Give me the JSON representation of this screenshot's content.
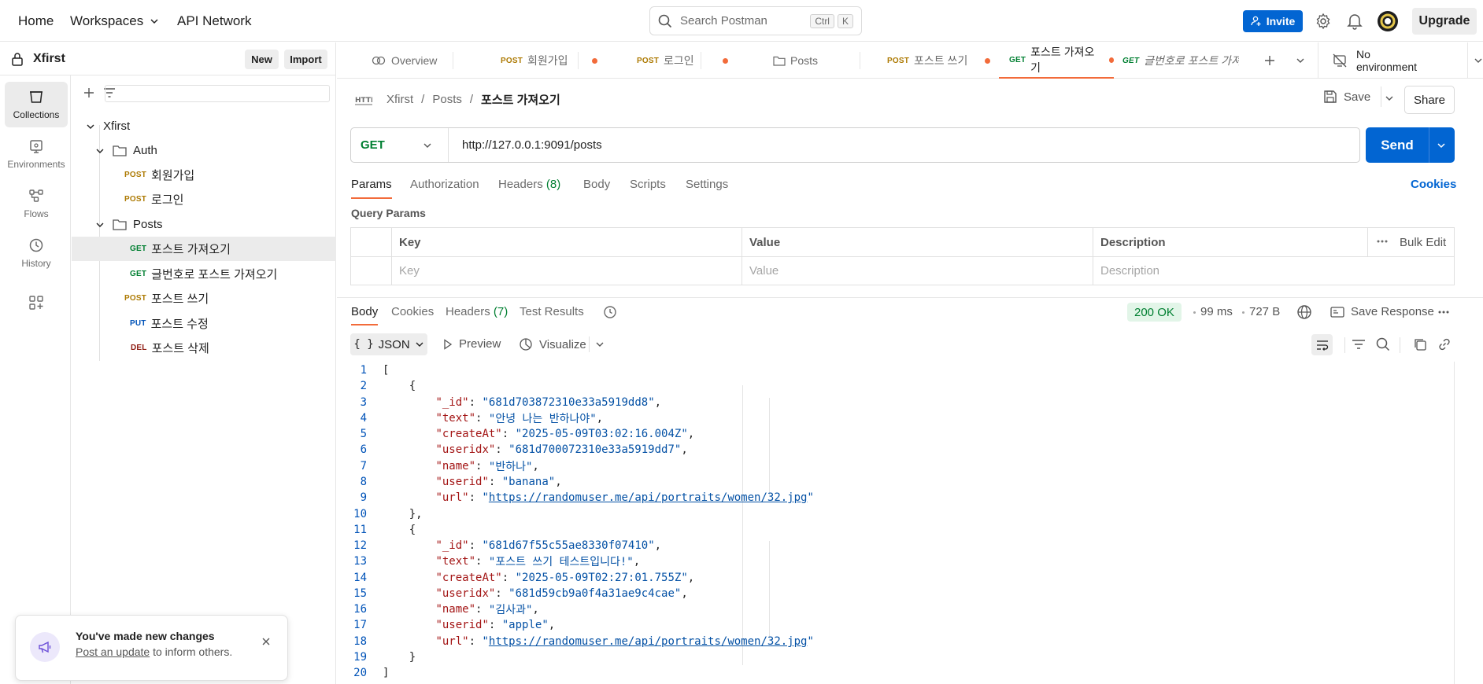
{
  "topbar": {
    "home": "Home",
    "workspaces": "Workspaces",
    "api_network": "API Network",
    "search_placeholder": "Search Postman",
    "kbd_ctrl": "Ctrl",
    "kbd_k": "K",
    "invite": "Invite",
    "upgrade": "Upgrade"
  },
  "workspace": {
    "name": "Xfirst",
    "new_label": "New",
    "import_label": "Import"
  },
  "rail": [
    {
      "label": "Collections",
      "icon": "collections-icon"
    },
    {
      "label": "Environments",
      "icon": "environments-icon"
    },
    {
      "label": "Flows",
      "icon": "flows-icon"
    },
    {
      "label": "History",
      "icon": "history-icon"
    }
  ],
  "tree": {
    "collection": "Xfirst",
    "auth_folder": "Auth",
    "posts_folder": "Posts",
    "items": [
      {
        "method": "POST",
        "name": "회원가입"
      },
      {
        "method": "POST",
        "name": "로그인"
      },
      {
        "method": "GET",
        "name": "포스트 가져오기"
      },
      {
        "method": "GET",
        "name": "글번호로 포스트 가져오기"
      },
      {
        "method": "POST",
        "name": "포스트 쓰기"
      },
      {
        "method": "PUT",
        "name": "포스트 수정"
      },
      {
        "method": "DEL",
        "name": "포스트 삭제"
      }
    ]
  },
  "tabs": [
    {
      "method": "",
      "label": "Overview"
    },
    {
      "method": "POST",
      "label": "회원가입"
    },
    {
      "method": "POST",
      "label": "로그인"
    },
    {
      "method": "",
      "label": "Posts"
    },
    {
      "method": "POST",
      "label": "포스트 쓰기"
    },
    {
      "method": "GET",
      "label": "포스트 가져오기"
    },
    {
      "method": "GET",
      "label": "글번호로 포스트 가져"
    }
  ],
  "environment": "No environment",
  "breadcrumb": {
    "root": "Xfirst",
    "folder": "Posts",
    "current": "포스트 가져오기",
    "sep": "/"
  },
  "actions": {
    "save": "Save",
    "share": "Share"
  },
  "request": {
    "method": "GET",
    "url": "http://127.0.0.1:9091/posts",
    "send": "Send"
  },
  "request_tabs": {
    "params": "Params",
    "authorization": "Authorization",
    "headers": "Headers",
    "headers_count": "(8)",
    "body": "Body",
    "scripts": "Scripts",
    "settings": "Settings",
    "cookies": "Cookies"
  },
  "params": {
    "title": "Query Params",
    "col_key": "Key",
    "col_value": "Value",
    "col_description": "Description",
    "bulk_edit": "Bulk Edit",
    "ph_key": "Key",
    "ph_value": "Value",
    "ph_description": "Description"
  },
  "response": {
    "body": "Body",
    "cookies": "Cookies",
    "headers": "Headers",
    "headers_count": "(7)",
    "test_results": "Test Results",
    "status": "200 OK",
    "time": "99 ms",
    "size": "727 B",
    "save_response": "Save Response",
    "format": "JSON",
    "preview": "Preview",
    "visualize": "Visualize"
  },
  "records": [
    {
      "_id": "681d703872310e33a5919dd8",
      "text": "안녕 나는 반하나야",
      "createAt": "2025-05-09T03:02:16.004Z",
      "useridx": "681d700072310e33a5919dd7",
      "name": "반하나",
      "userid": "banana",
      "url": "https://randomuser.me/api/portraits/women/32.jpg"
    },
    {
      "_id": "681d67f55c55ae8330f07410",
      "text": "포스트 쓰기 테스트입니다!",
      "createAt": "2025-05-09T02:27:01.755Z",
      "useridx": "681d59cb9a0f4a31ae9c4cae",
      "name": "김사과",
      "userid": "apple",
      "url": "https://randomuser.me/api/portraits/women/32.jpg"
    }
  ],
  "toast": {
    "title": "You've made new changes",
    "link": "Post an update",
    "rest": " to inform others."
  }
}
